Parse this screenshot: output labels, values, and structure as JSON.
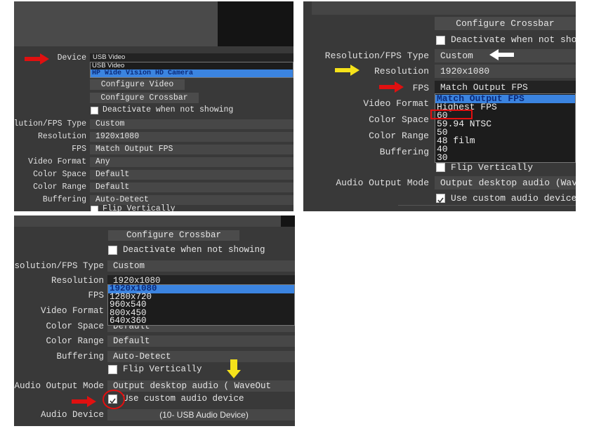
{
  "colors": {
    "panel_bg": "#393939",
    "field_bg": "#474747",
    "dropdown_bg": "#1c1c1c",
    "highlight": "#3b84e0",
    "arrow_red": "#e01010",
    "arrow_yellow": "#f5e21a",
    "arrow_white": "#ffffff"
  },
  "panel1": {
    "device_label": "Device",
    "device_value": "USB Video",
    "device_options": [
      "USB Video",
      "HP Wide Vision HD Camera"
    ],
    "configure_video": "Configure Video",
    "configure_crossbar": "Configure Crossbar",
    "deactivate": "Deactivate when not showing",
    "rows": [
      {
        "label": "Resolution/FPS Type",
        "value": "Custom"
      },
      {
        "label": "Resolution",
        "value": "1920x1080"
      },
      {
        "label": "FPS",
        "value": "Match Output FPS"
      },
      {
        "label": "Video Format",
        "value": "Any"
      },
      {
        "label": "Color Space",
        "value": "Default"
      },
      {
        "label": "Color Range",
        "value": "Default"
      },
      {
        "label": "Buffering",
        "value": "Auto-Detect"
      }
    ],
    "flip": "Flip Vertically"
  },
  "panel2": {
    "configure_crossbar": "Configure Crossbar",
    "deactivate": "Deactivate when not showing",
    "res_type_label": "Resolution/FPS Type",
    "res_type_value": "Custom",
    "resolution_label": "Resolution",
    "resolution_value": "1920x1080",
    "fps_label": "FPS",
    "fps_value": "Match Output FPS",
    "fps_options": [
      "Match Output FPS",
      "Highest FPS",
      "60",
      "59.94 NTSC",
      "50",
      "48 film",
      "40",
      "30"
    ],
    "labels": [
      "Video Format",
      "Color Space",
      "Color Range",
      "Buffering"
    ],
    "flip": "Flip Vertically",
    "audio_mode_label": "Audio Output Mode",
    "audio_mode_value": "Output desktop audio (WaveOut)",
    "custom_audio": "Use custom audio device"
  },
  "panel3": {
    "configure_crossbar": "Configure Crossbar",
    "deactivate": "Deactivate when not showing",
    "res_type_label": "Resolution/FPS Type",
    "res_type_value": "Custom",
    "resolution_label": "Resolution",
    "resolution_value": "1920x1080",
    "resolution_options": [
      "1920x1080",
      "1280x720",
      "960x540",
      "800x450",
      "640x360"
    ],
    "fps_label": "FPS",
    "video_format_label": "Video Format",
    "color_space_label": "Color Space",
    "color_space_value": "Default",
    "color_range_label": "Color Range",
    "color_range_value": "Default",
    "buffering_label": "Buffering",
    "buffering_value": "Auto-Detect",
    "flip": "Flip Vertically",
    "audio_mode_label": "Audio Output Mode",
    "audio_mode_value": "Output desktop audio ( WaveOut",
    "custom_audio": "Use custom audio device",
    "custom_audio_checked": true,
    "audio_device_label": "Audio Device",
    "audio_device_value": "(10- USB Audio Device)"
  }
}
